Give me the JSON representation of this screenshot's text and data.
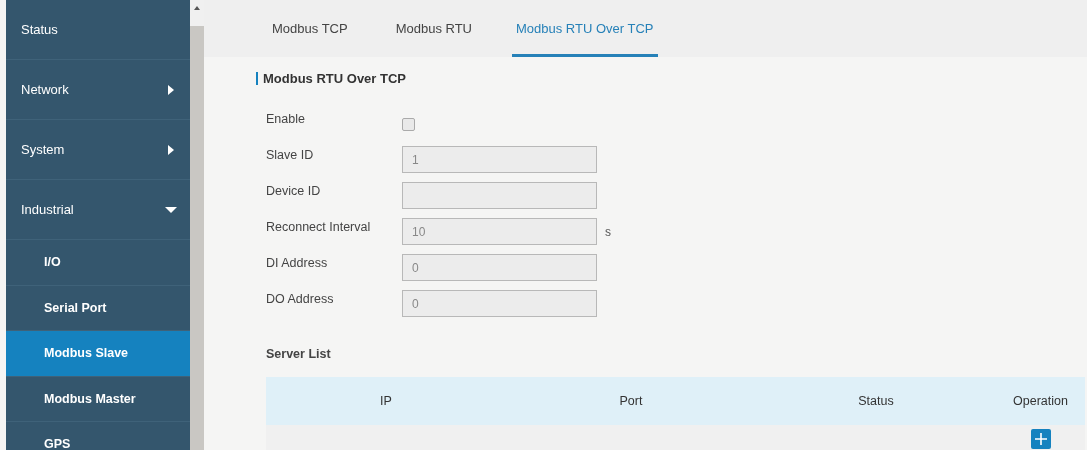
{
  "sidebar": {
    "items": [
      {
        "label": "Status",
        "selected": false
      },
      {
        "label": "Network",
        "selected": false,
        "expanded": false
      },
      {
        "label": "System",
        "selected": false,
        "expanded": false
      },
      {
        "label": "Industrial",
        "selected": false,
        "expanded": true,
        "children": [
          {
            "label": "I/O",
            "selected": false
          },
          {
            "label": "Serial Port",
            "selected": false
          },
          {
            "label": "Modbus Slave",
            "selected": true
          },
          {
            "label": "Modbus Master",
            "selected": false
          },
          {
            "label": "GPS",
            "selected": false
          }
        ]
      }
    ]
  },
  "tabs": [
    {
      "label": "Modbus TCP",
      "selected": false
    },
    {
      "label": "Modbus RTU",
      "selected": false
    },
    {
      "label": "Modbus RTU Over TCP",
      "selected": true
    }
  ],
  "section_title": "Modbus RTU Over TCP",
  "form": [
    {
      "kind": "checkbox",
      "label": "Enable",
      "checked": false
    },
    {
      "kind": "text",
      "label": "Slave ID",
      "value": "1"
    },
    {
      "kind": "text",
      "label": "Device ID"
    },
    {
      "kind": "text",
      "label": "Reconnect Interval",
      "value": "10",
      "unit": "s"
    },
    {
      "kind": "text",
      "label": "DI Address",
      "value": "0"
    },
    {
      "kind": "text",
      "label": "DO Address",
      "value": "0"
    }
  ],
  "server_list": {
    "title": "Server List",
    "columns": [
      "IP",
      "Port",
      "Status",
      "Operation"
    ]
  }
}
